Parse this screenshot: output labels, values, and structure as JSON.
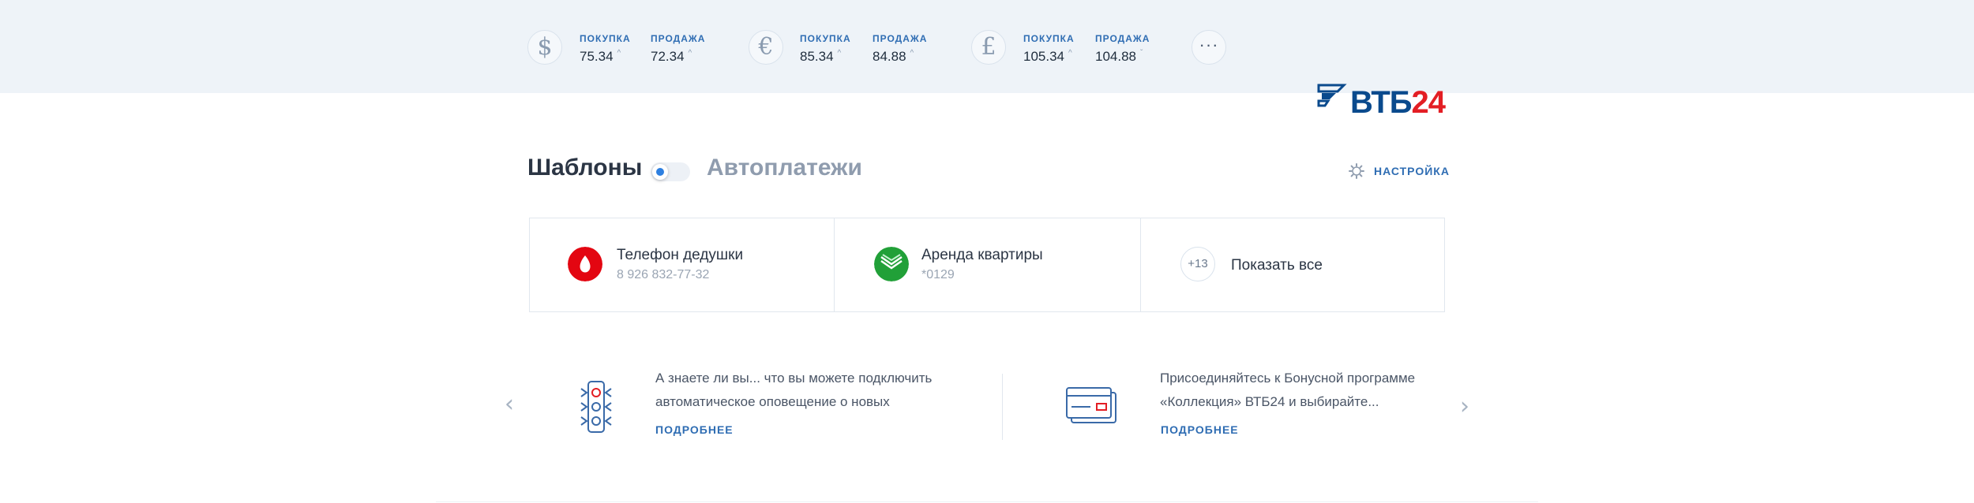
{
  "rates": [
    {
      "symbol": "$",
      "icon": "dollar-icon",
      "buy_label": "ПОКУПКА",
      "buy_value": "75.34",
      "sell_label": "ПРОДАЖА",
      "sell_value": "72.34"
    },
    {
      "symbol": "€",
      "icon": "euro-icon",
      "buy_label": "ПОКУПКА",
      "buy_value": "85.34",
      "sell_label": "ПРОДАЖА",
      "sell_value": "84.88"
    },
    {
      "symbol": "£",
      "icon": "pound-icon",
      "buy_label": "ПОКУПКА",
      "buy_value": "105.34",
      "sell_label": "ПРОДАЖА",
      "sell_value": "104.88"
    }
  ],
  "more_rates_glyph": "···",
  "logo": {
    "text_blue": "ВТБ",
    "text_red": "24"
  },
  "templates": {
    "title": "Шаблоны",
    "autopay_title": "Автоплатежи",
    "settings_label": "НАСТРОЙКА",
    "items": [
      {
        "title": "Телефон дедушки",
        "subtitle": "8 926 832-77-32",
        "icon": "mts-logo-icon",
        "color": "#e30611"
      },
      {
        "title": "Аренда квартиры",
        "subtitle": "*0129",
        "icon": "sberbank-logo-icon",
        "color": "#21a038"
      }
    ],
    "more_count": "+13",
    "show_all_label": "Показать все"
  },
  "promos": [
    {
      "text": "А знаете ли вы... что вы можете подключить автоматическое оповещение о новых",
      "link": "ПОДРОБНЕЕ",
      "icon": "traffic-light-icon"
    },
    {
      "text": "Присоединяйтесь к Бонусной программе «Коллекция» ВТБ24 и выбирайте...",
      "link": "ПОДРОБНЕЕ",
      "icon": "credit-card-icon"
    }
  ],
  "colors": {
    "accent": "#2f6db3",
    "brand_blue": "#0a4a8d",
    "brand_red": "#e31e24",
    "topbar_bg": "#eef3f8"
  }
}
